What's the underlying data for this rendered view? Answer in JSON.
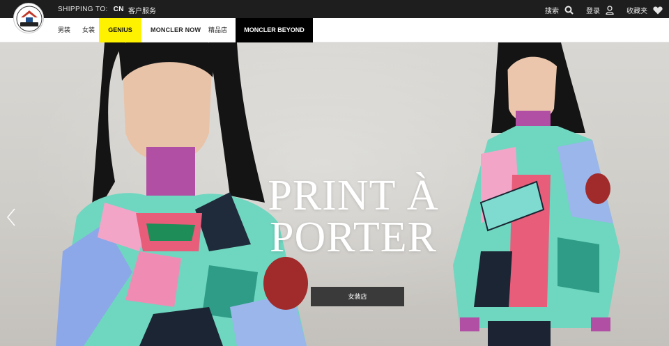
{
  "topbar": {
    "shipping_label": "SHIPPING TO:",
    "shipping_country": "CN",
    "customer_service": "客户服务",
    "search_label": "搜索",
    "login_label": "登录",
    "wishlist_label": "收藏夹"
  },
  "brand": {
    "logo_text": "MONCLER"
  },
  "nav": {
    "items": [
      {
        "label": "男装"
      },
      {
        "label": "女装"
      },
      {
        "label": "GENIUS"
      },
      {
        "label": "MONCLER NOW"
      },
      {
        "label": "精品店"
      },
      {
        "label": "MONCLER BEYOND"
      }
    ]
  },
  "hero": {
    "title_line1": "PRINT À",
    "title_line2": "PORTER",
    "cta_label": "女装店"
  },
  "colors": {
    "topbar_bg": "#1e1e1e",
    "genius_bg": "#fff200",
    "beyond_bg": "#000000",
    "cta_bg": "#3a3a3a"
  },
  "icons": [
    "search-icon",
    "user-icon",
    "heart-icon",
    "chevron-left-icon"
  ]
}
